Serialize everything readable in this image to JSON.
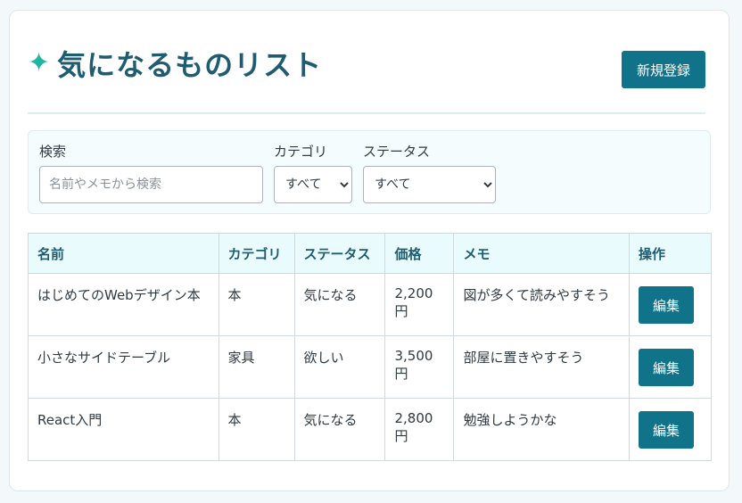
{
  "header": {
    "title": "気になるものリスト",
    "sparkle": "✦",
    "new_button": "新規登録"
  },
  "filters": {
    "search_label": "検索",
    "search_placeholder": "名前やメモから検索",
    "category_label": "カテゴリ",
    "category_value": "すべて",
    "status_label": "ステータス",
    "status_value": "すべて"
  },
  "table": {
    "headers": [
      "名前",
      "カテゴリ",
      "ステータス",
      "価格",
      "メモ",
      "操作"
    ],
    "rows": [
      {
        "name": "はじめてのWebデザイン本",
        "category": "本",
        "status": "気になる",
        "price": "2,200円",
        "memo": "図が多くて読みやすそう",
        "action": "編集"
      },
      {
        "name": "小さなサイドテーブル",
        "category": "家具",
        "status": "欲しい",
        "price": "3,500円",
        "memo": "部屋に置きやすそう",
        "action": "編集"
      },
      {
        "name": "React入門",
        "category": "本",
        "status": "気になる",
        "price": "2,800円",
        "memo": "勉強しようかな",
        "action": "編集"
      }
    ]
  },
  "colors": {
    "accent": "#11738a",
    "title": "#1d5c71",
    "sparkle": "#1fb5a3",
    "table_header_bg": "#e9fbfd"
  }
}
